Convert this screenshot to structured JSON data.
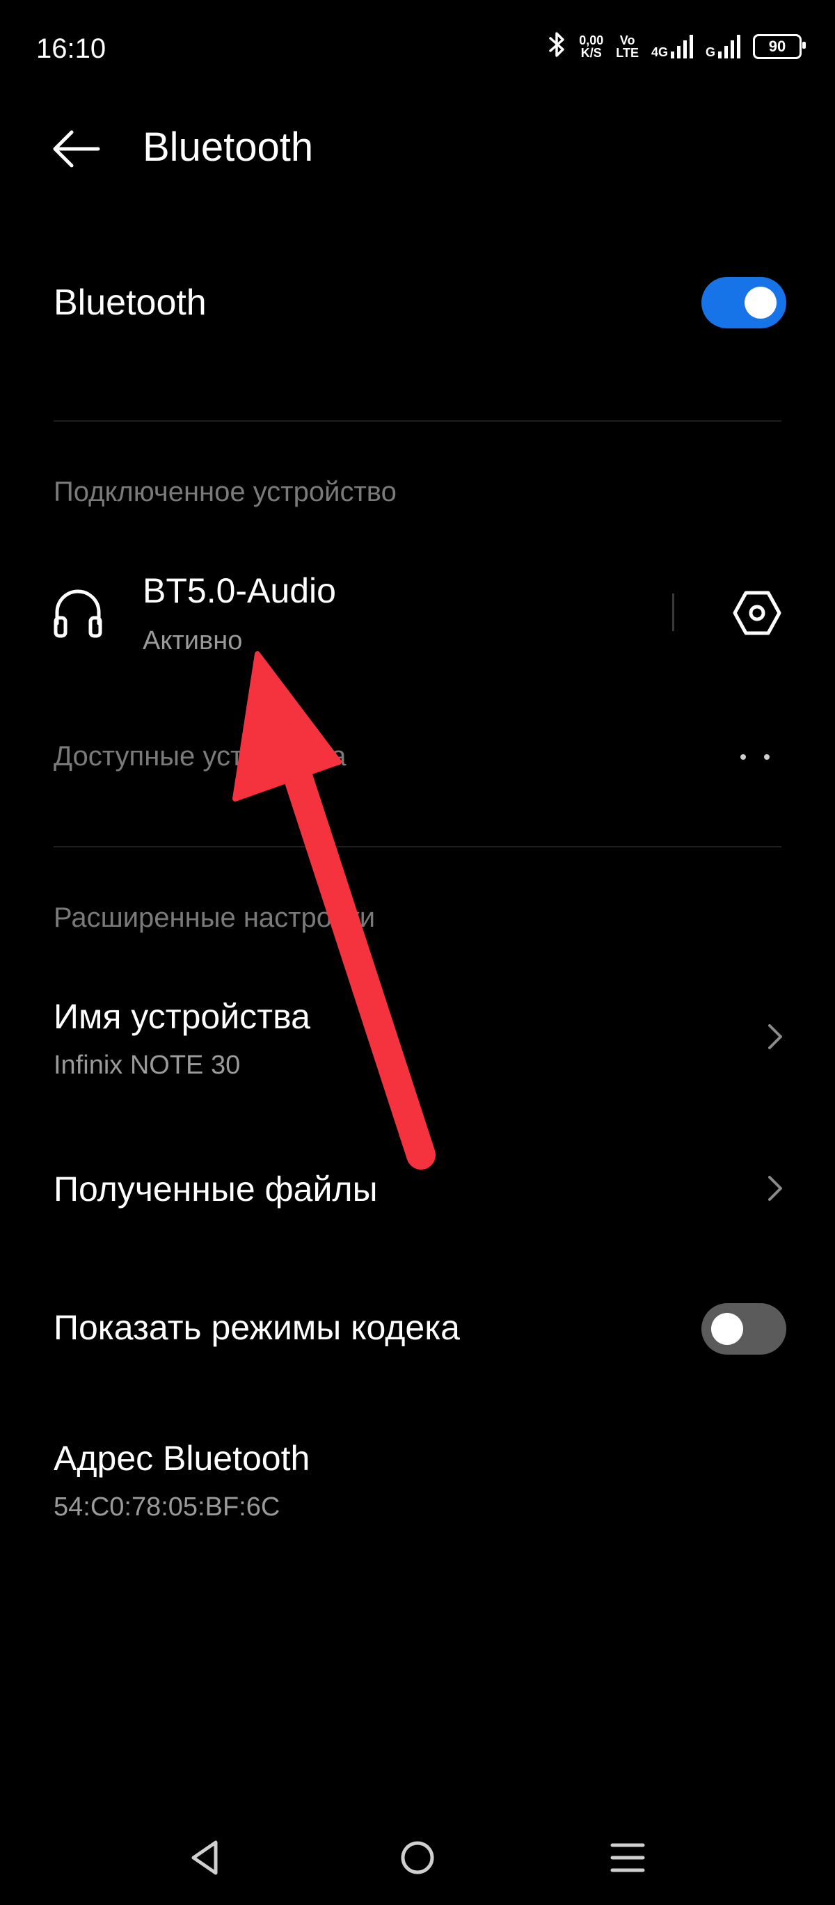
{
  "status_bar": {
    "time": "16:10",
    "net_speed_value": "0,00",
    "net_speed_unit": "K/S",
    "volte_top": "Vo",
    "volte_bottom": "LTE",
    "net_4g": "4G",
    "net_g": "G",
    "battery": "90"
  },
  "header": {
    "title": "Bluetooth"
  },
  "bluetooth_toggle": {
    "label": "Bluetooth",
    "enabled": true
  },
  "connected_section": {
    "label": "Подключенное устройство",
    "device_name": "BT5.0-Audio",
    "device_status": "Активно"
  },
  "available_section": {
    "label": "Доступные устройства"
  },
  "advanced_section": {
    "label": "Расширенные настройки",
    "device_name_label": "Имя устройства",
    "device_name_value": "Infinix NOTE 30",
    "received_files_label": "Полученные файлы",
    "codec_modes_label": "Показать режимы кодека",
    "codec_modes_enabled": false,
    "bt_address_label": "Адрес Bluetooth",
    "bt_address_value": "54:C0:78:05:BF:6C"
  },
  "colors": {
    "accent": "#1773e8",
    "annotation_arrow": "#f5333f"
  }
}
